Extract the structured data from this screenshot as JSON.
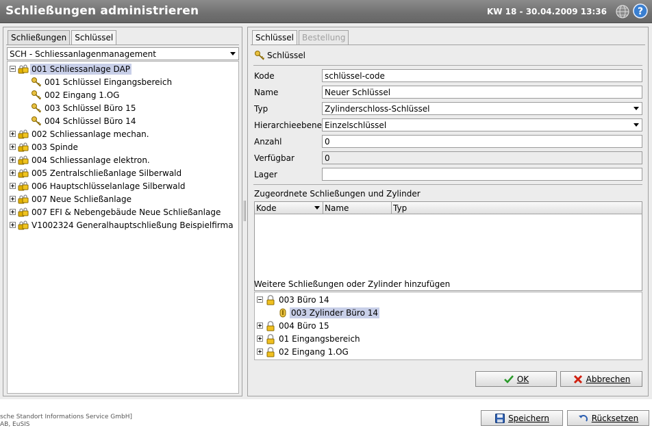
{
  "header": {
    "title": "Schließungen administrieren",
    "date": "KW 18 - 30.04.2009 13:36",
    "globe_icon": "globe-icon",
    "help_icon": "help-icon"
  },
  "left": {
    "tabs": [
      {
        "label": "Schließungen"
      },
      {
        "label": "Schlüssel"
      }
    ],
    "dropdown": "SCH - Schliessanlagenmanagement",
    "tree": [
      {
        "label": "001 Schliessanlage  DAP"
      },
      {
        "label": "001 Schlüssel Eingangsbereich"
      },
      {
        "label": "002 Eingang 1.OG"
      },
      {
        "label": "003 Schlüssel Büro 15"
      },
      {
        "label": "004 Schlüssel Büro 14"
      },
      {
        "label": "002 Schliessanlage mechan."
      },
      {
        "label": "003 Spinde"
      },
      {
        "label": "004 Schliessanlage elektron."
      },
      {
        "label": "005 Zentralschließanlage Silberwald"
      },
      {
        "label": "006 Hauptschlüsselanlage Silberwald"
      },
      {
        "label": "007 Neue Schließanlage"
      },
      {
        "label": "007 EFI & Nebengebäude Neue Schließanlage"
      },
      {
        "label": "V1002324 Generalhauptschließung Beispielfirma"
      }
    ]
  },
  "right": {
    "tabs": [
      {
        "label": "Schlüssel"
      },
      {
        "label": "Bestellung"
      }
    ],
    "heading": "Schlüssel",
    "fields": {
      "kode": {
        "label": "Kode",
        "value": "schlüssel-code"
      },
      "name": {
        "label": "Name",
        "value": "Neuer Schlüssel"
      },
      "typ": {
        "label": "Typ",
        "value": "Zylinderschloss-Schlüssel"
      },
      "hierarchie": {
        "label": "Hierarchieebene",
        "value": "Einzelschlüssel"
      },
      "anzahl": {
        "label": "Anzahl",
        "value": "0"
      },
      "verfuegbar": {
        "label": "Verfügbar",
        "value": "0"
      },
      "lager": {
        "label": "Lager",
        "value": ""
      }
    },
    "assigned": {
      "title": "Zugeordnete Schließungen und Zylinder",
      "columns": [
        "Kode",
        "Name",
        "Typ"
      ]
    },
    "more": {
      "title": "Weitere Schließungen oder Zylinder hinzufügen",
      "tree": [
        {
          "label": "003 Büro 14"
        },
        {
          "label": "003 Zylinder Büro 14"
        },
        {
          "label": "004 Büro 15"
        },
        {
          "label": "01 Eingangsbereich"
        },
        {
          "label": "02 Eingang 1.OG"
        }
      ]
    },
    "ok_label": "OK",
    "cancel_label": "Abbrechen"
  },
  "footer": {
    "line1": "sche Standort Informations Service GmbH]",
    "line2": "AB, EuSIS",
    "save_label": "Speichern",
    "reset_label": "Rücksetzen"
  },
  "colors": {
    "titlebar": "#707070",
    "selection": "#c8cfe8",
    "lock": "#e0b000",
    "ok_check": "#2a9a2a",
    "cancel_x": "#d02010"
  }
}
